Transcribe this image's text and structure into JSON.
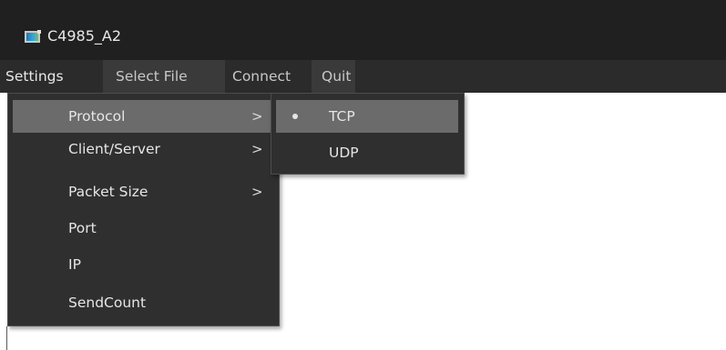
{
  "window": {
    "title": "C4985_A2",
    "app_icon": "app-window-icon"
  },
  "menubar": {
    "items": [
      {
        "label": "Settings",
        "active": false
      },
      {
        "label": "Select File",
        "active": true
      },
      {
        "label": "Connect",
        "active": false
      },
      {
        "label": "Quit",
        "active": true
      }
    ]
  },
  "settings_menu": {
    "items": [
      {
        "label": "Protocol",
        "has_submenu": true,
        "highlighted": true,
        "arrow": ">"
      },
      {
        "label": "Client/Server",
        "has_submenu": true,
        "highlighted": false,
        "arrow": ">"
      },
      {
        "label": "Packet Size",
        "has_submenu": true,
        "highlighted": false,
        "arrow": ">"
      },
      {
        "label": "Port",
        "has_submenu": false,
        "highlighted": false
      },
      {
        "label": "IP",
        "has_submenu": false,
        "highlighted": false
      },
      {
        "label": "SendCount",
        "has_submenu": false,
        "highlighted": false
      }
    ]
  },
  "protocol_submenu": {
    "items": [
      {
        "label": "TCP",
        "selected": true,
        "highlighted": true
      },
      {
        "label": "UDP",
        "selected": false,
        "highlighted": false
      }
    ]
  },
  "colors": {
    "titlebar_bg": "#202020",
    "menubar_bg": "#2b2b2b",
    "menu_bg": "#2f2f2f",
    "highlight_bg": "#6b6b6b",
    "text": "#e6e6e6"
  }
}
